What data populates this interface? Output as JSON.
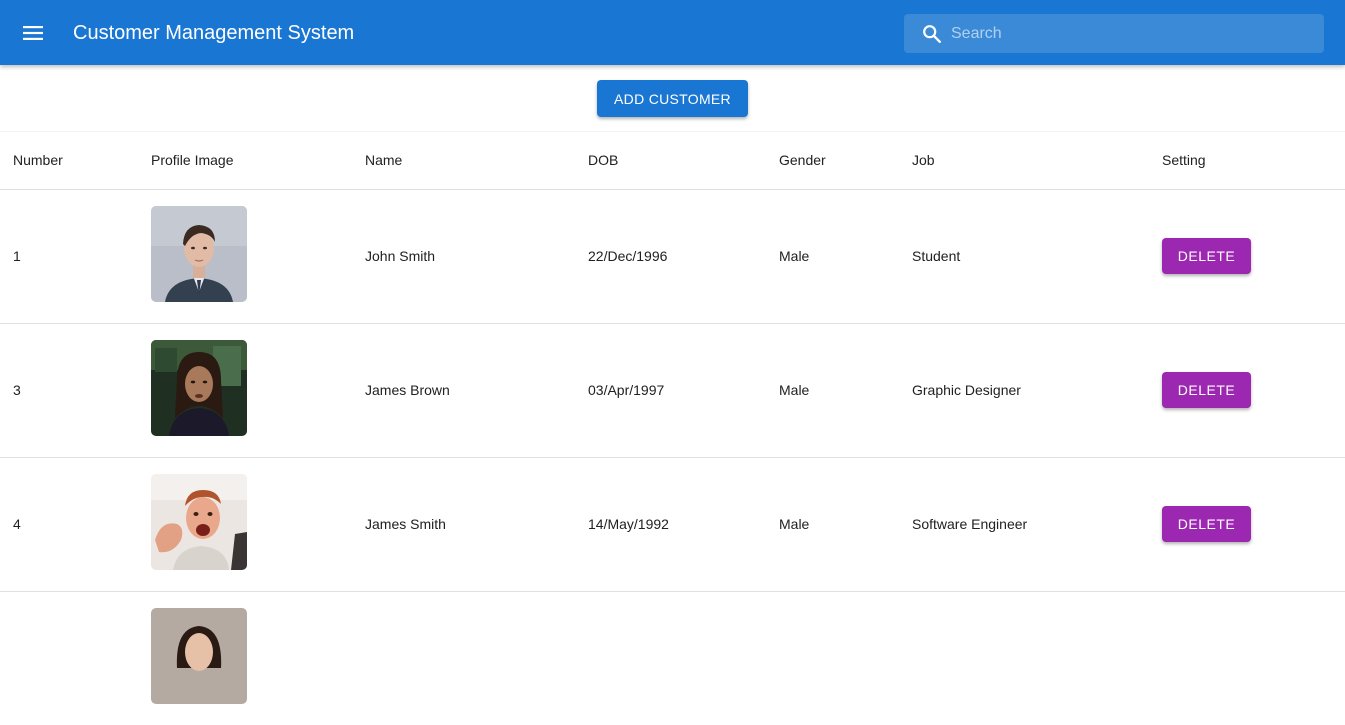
{
  "app": {
    "title": "Customer Management System",
    "search_placeholder": "Search",
    "search_value": ""
  },
  "toolbar": {
    "add_label": "ADD CUSTOMER"
  },
  "table": {
    "headers": {
      "number": "Number",
      "image": "Profile Image",
      "name": "Name",
      "dob": "DOB",
      "gender": "Gender",
      "job": "Job",
      "setting": "Setting"
    },
    "rows": [
      {
        "number": "1",
        "name": "John Smith",
        "dob": "22/Dec/1996",
        "gender": "Male",
        "job": "Student",
        "action": "DELETE"
      },
      {
        "number": "3",
        "name": "James Brown",
        "dob": "03/Apr/1997",
        "gender": "Male",
        "job": "Graphic Designer",
        "action": "DELETE"
      },
      {
        "number": "4",
        "name": "James Smith",
        "dob": "14/May/1992",
        "gender": "Male",
        "job": "Software Engineer",
        "action": "DELETE"
      },
      {
        "number": "",
        "name": "",
        "dob": "",
        "gender": "",
        "job": "",
        "action": ""
      }
    ]
  },
  "colors": {
    "primary": "#1976d2",
    "secondary": "#9c27b0"
  },
  "icons": {
    "menu": "menu-icon",
    "search": "search-icon"
  }
}
